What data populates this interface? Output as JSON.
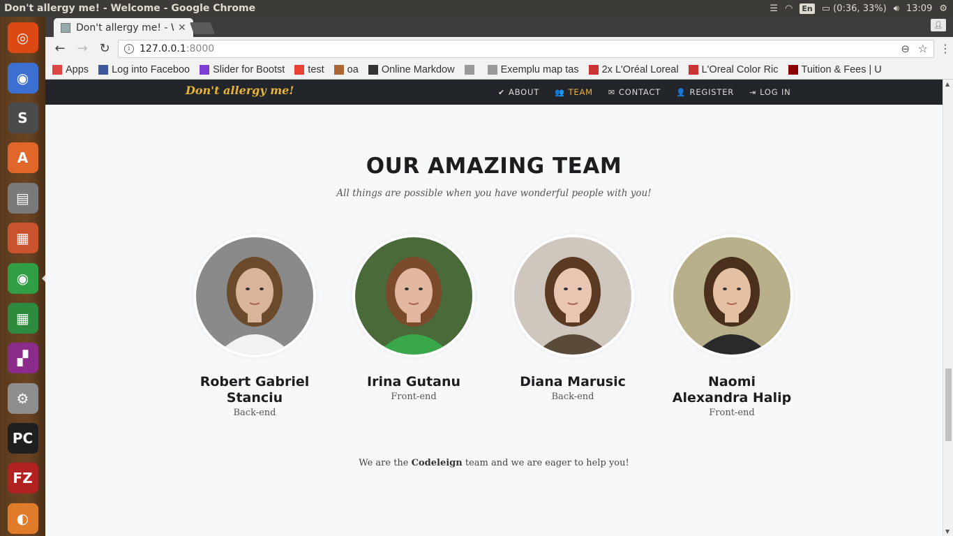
{
  "os": {
    "window_title": "Don't allergy me! - Welcome - Google Chrome",
    "battery": "(0:36, 33%)",
    "keyboard_lang": "En",
    "clock": "13:09"
  },
  "launcher": {
    "items": [
      {
        "name": "ubuntu-dash-icon",
        "color": "#dd4814",
        "glyph": "◎"
      },
      {
        "name": "chromium-icon",
        "color": "#3b6fd1",
        "glyph": "◉"
      },
      {
        "name": "sublime-text-icon",
        "color": "#4b4b4b",
        "glyph": "S"
      },
      {
        "name": "software-center-icon",
        "color": "#e0662a",
        "glyph": "A"
      },
      {
        "name": "files-icon",
        "color": "#7a7a7a",
        "glyph": "▤"
      },
      {
        "name": "impress-icon",
        "color": "#c8532c",
        "glyph": "▦"
      },
      {
        "name": "chrome-icon",
        "color": "#2f9e44",
        "glyph": "◉"
      },
      {
        "name": "calc-icon",
        "color": "#2e8b3e",
        "glyph": "▦"
      },
      {
        "name": "workspaces-icon",
        "color": "#8b2c8b",
        "glyph": "▞"
      },
      {
        "name": "settings-icon",
        "color": "#8e8e8e",
        "glyph": "⚙"
      },
      {
        "name": "pycharm-icon",
        "color": "#1f1f1f",
        "glyph": "PC"
      },
      {
        "name": "filezilla-icon",
        "color": "#b22222",
        "glyph": "FZ"
      },
      {
        "name": "disk-icon",
        "color": "#e07b2a",
        "glyph": "◐"
      }
    ]
  },
  "browser": {
    "tab_title": "Don't allergy me! - W",
    "url_host": "127.0.0.1",
    "url_port": ":8000",
    "bookmarks": [
      {
        "label": "Apps",
        "icon": "apps-grid-icon",
        "color": "#d44"
      },
      {
        "label": "Log into Faceboo",
        "icon": "facebook-icon",
        "color": "#3b5998"
      },
      {
        "label": "Slider for Bootst",
        "icon": "slider-icon",
        "color": "#7b3fd6"
      },
      {
        "label": "test",
        "icon": "google-icon",
        "color": "#ea4335"
      },
      {
        "label": "oa",
        "icon": "hash-icon",
        "color": "#a63"
      },
      {
        "label": "Online Markdow",
        "icon": "markdown-icon",
        "color": "#333"
      },
      {
        "label": "",
        "icon": "page-icon",
        "color": "#999"
      },
      {
        "label": "Exemplu map tas",
        "icon": "page-icon",
        "color": "#999"
      },
      {
        "label": "2x L'Oréal Loreal",
        "icon": "loreal-icon",
        "color": "#c33"
      },
      {
        "label": "L'Oreal Color Ric",
        "icon": "loreal-icon",
        "color": "#c33"
      },
      {
        "label": "Tuition & Fees | U",
        "icon": "university-icon",
        "color": "#8b0000"
      }
    ],
    "more": "»"
  },
  "site": {
    "brand": "Don't allergy me!",
    "nav": [
      {
        "label": "ABOUT",
        "icon": "check-icon",
        "glyph": "✔",
        "active": false
      },
      {
        "label": "TEAM",
        "icon": "users-icon",
        "glyph": "👥",
        "active": true
      },
      {
        "label": "CONTACT",
        "icon": "envelope-icon",
        "glyph": "✉",
        "active": false
      },
      {
        "label": "REGISTER",
        "icon": "user-icon",
        "glyph": "👤",
        "active": false
      },
      {
        "label": "LOG IN",
        "icon": "login-icon",
        "glyph": "⇥",
        "active": false
      }
    ],
    "section_title": "OUR AMAZING TEAM",
    "section_subtitle": "All things are possible when you have wonderful people with you!",
    "members": [
      {
        "name": "Robert Gabriel Stanciu",
        "role": "Back-end",
        "bg": "#8a8a8a",
        "skin": "#d9b49a",
        "hair": "#6b4a2b",
        "shirt": "#f2f2f2"
      },
      {
        "name": "Irina Gutanu",
        "role": "Front-end",
        "bg": "#4a6a3a",
        "skin": "#e2b9a0",
        "hair": "#7a4a2a",
        "shirt": "#3aa84a"
      },
      {
        "name": "Diana Marusic",
        "role": "Back-end",
        "bg": "#cfc6bd",
        "skin": "#e9c6b2",
        "hair": "#5a3a22",
        "shirt": "#5a4a3a"
      },
      {
        "name": "Naomi Alexandra Halip",
        "role": "Front-end",
        "bg": "#b8b08a",
        "skin": "#e6c0a2",
        "hair": "#4a2f1c",
        "shirt": "#2a2a2a"
      }
    ],
    "footer_pre": "We are the ",
    "footer_team": "Codeleign",
    "footer_post": " team and we are eager to help you!"
  }
}
